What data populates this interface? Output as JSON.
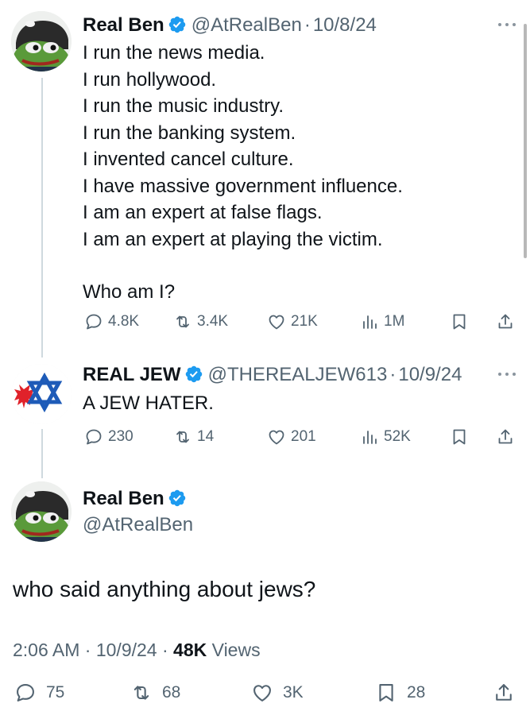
{
  "tweet1": {
    "name": "Real Ben",
    "handle": "@AtRealBen",
    "sep": "·",
    "date": "10/8/24",
    "lines": [
      "I run the news media.",
      "I run hollywood.",
      "I run the music industry.",
      "I run the banking system.",
      "I invented cancel culture.",
      "I have massive government influence.",
      "I am an expert at false flags.",
      "I am an expert at playing the victim."
    ],
    "question": "Who am I?",
    "stats": {
      "replies": "4.8K",
      "reposts": "3.4K",
      "likes": "21K",
      "views": "1M"
    }
  },
  "tweet2": {
    "name": "REAL JEW",
    "handle": "@THEREALJEW613",
    "sep": "·",
    "date": "10/9/24",
    "text": "A JEW HATER.",
    "stats": {
      "replies": "230",
      "reposts": "14",
      "likes": "201",
      "views": "52K"
    }
  },
  "main": {
    "name": "Real Ben",
    "handle": "@AtRealBen",
    "text": "who said anything about jews?",
    "time": "2:06 AM",
    "sep": "·",
    "date": "10/9/24",
    "views_count": "48K",
    "views_label": "Views",
    "stats": {
      "replies": "75",
      "reposts": "68",
      "likes": "3K",
      "bookmarks": "28"
    }
  },
  "colors": {
    "verified": "#1d9bf0",
    "text": "#0f1419",
    "secondary": "#536471",
    "line": "#cfd9de"
  },
  "icons": [
    "reply-icon",
    "repost-icon",
    "like-icon",
    "views-icon",
    "bookmark-icon",
    "share-icon",
    "more-icon",
    "verified-badge-icon"
  ]
}
